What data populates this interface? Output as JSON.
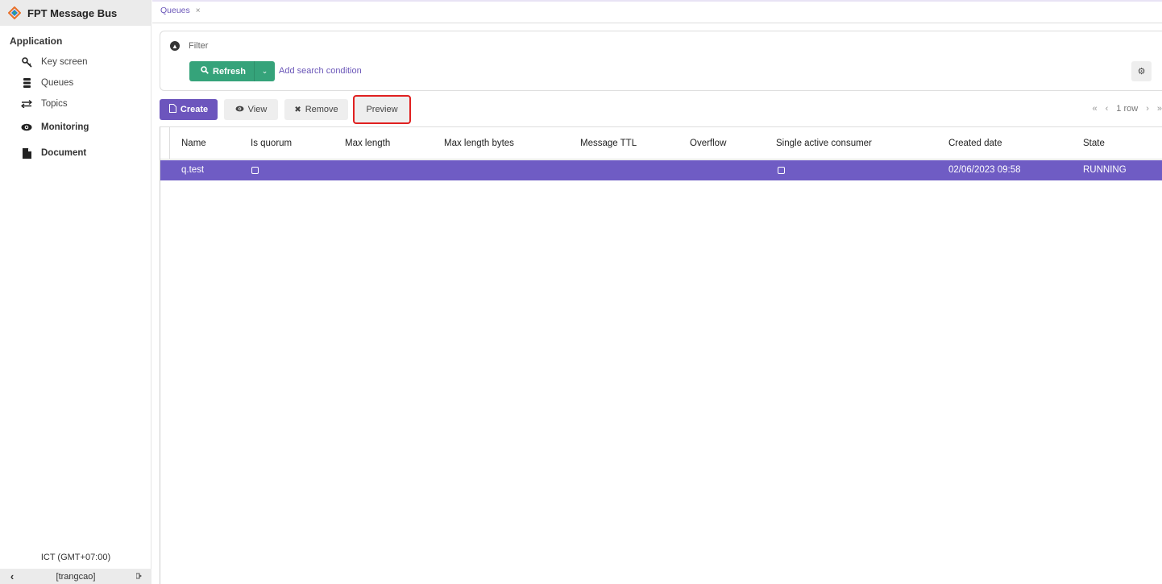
{
  "app": {
    "title": "FPT Message Bus"
  },
  "sidebar": {
    "section": "Application",
    "items": [
      {
        "label": "Key screen",
        "icon": "key-icon"
      },
      {
        "label": "Queues",
        "icon": "database-icon"
      },
      {
        "label": "Topics",
        "icon": "exchange-icon"
      }
    ],
    "groups": [
      {
        "label": "Monitoring",
        "icon": "eye-icon"
      },
      {
        "label": "Document",
        "icon": "file-icon"
      }
    ],
    "timezone": "ICT (GMT+07:00)",
    "user": "[trangcao]"
  },
  "tabs": [
    {
      "label": "Queues",
      "close": "×"
    }
  ],
  "filter": {
    "label": "Filter",
    "refresh_label": "Refresh",
    "add_condition_label": "Add search condition"
  },
  "toolbar": {
    "create_label": "Create",
    "view_label": "View",
    "remove_label": "Remove",
    "preview_label": "Preview"
  },
  "pager": {
    "first": "«",
    "prev": "‹",
    "rows": "1 row",
    "next": "›",
    "last": "»"
  },
  "table": {
    "columns": [
      "Name",
      "Is quorum",
      "Max length",
      "Max length bytes",
      "Message TTL",
      "Overflow",
      "Single active consumer",
      "Created date",
      "State"
    ],
    "rows": [
      {
        "name": "q.test",
        "is_quorum": false,
        "max_length": "",
        "max_length_bytes": "",
        "message_ttl": "",
        "overflow": "",
        "single_active_consumer": false,
        "created_date": "02/06/2023 09:58",
        "state": "RUNNING"
      }
    ]
  },
  "colors": {
    "accent": "#6f5cc4",
    "refresh": "#35a37a",
    "highlight": "#e02020"
  }
}
